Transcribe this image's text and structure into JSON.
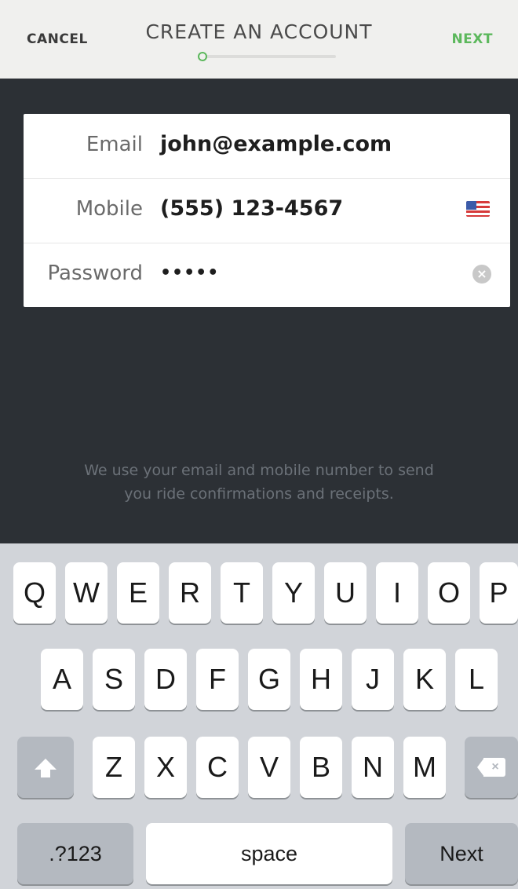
{
  "header": {
    "cancel_label": "CANCEL",
    "title": "CREATE AN ACCOUNT",
    "next_label": "NEXT",
    "progress_step": 1
  },
  "form": {
    "fields": [
      {
        "label": "Email",
        "value": "john@example.com"
      },
      {
        "label": "Mobile",
        "value": "(555) 123-4567",
        "flag_icon": "us-flag-icon"
      },
      {
        "label": "Password",
        "value": "•••••",
        "clear_icon": "clear-icon"
      }
    ]
  },
  "info_text": {
    "line1": "We use your email and mobile number to send",
    "line2": "you ride confirmations and receipts."
  },
  "keyboard": {
    "row1": [
      "Q",
      "W",
      "E",
      "R",
      "T",
      "Y",
      "U",
      "I",
      "O",
      "P"
    ],
    "row2": [
      "A",
      "S",
      "D",
      "F",
      "G",
      "H",
      "J",
      "K",
      "L"
    ],
    "row3": [
      "Z",
      "X",
      "C",
      "V",
      "B",
      "N",
      "M"
    ],
    "shift_icon": "shift-icon",
    "delete_icon": "delete-icon",
    "numbers_label": ".?123",
    "space_label": "space",
    "return_label": "Next"
  },
  "colors": {
    "accent": "#5cb85c",
    "background_dark": "#2c3035",
    "keyboard_bg": "#d1d4d9"
  }
}
